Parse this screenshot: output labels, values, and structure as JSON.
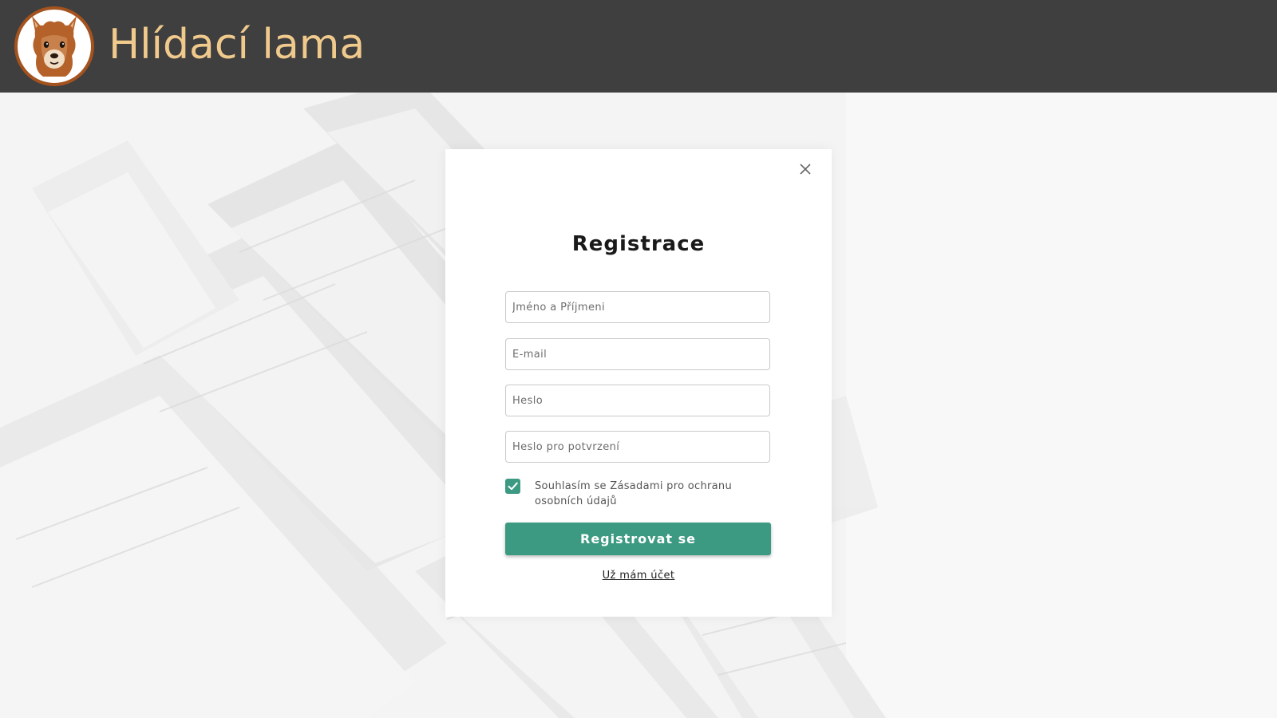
{
  "header": {
    "brand": "Hlídací lama",
    "logo_icon": "llama-logo-icon"
  },
  "colors": {
    "header_bg": "#3f3f3f",
    "brand_text": "#f0c98c",
    "accent": "#3d9a82"
  },
  "modal": {
    "close_icon": "close-icon",
    "title": "Registrace",
    "fields": {
      "name_placeholder": "Jméno a Příjmeni",
      "email_placeholder": "E-mail",
      "password_placeholder": "Heslo",
      "confirm_placeholder": "Heslo pro potvrzení"
    },
    "consent": {
      "checked": true,
      "label": "Souhlasím se Zásadami pro ochranu osobních údajů"
    },
    "submit_label": "Registrovat se",
    "login_link": "Už mám účet"
  }
}
